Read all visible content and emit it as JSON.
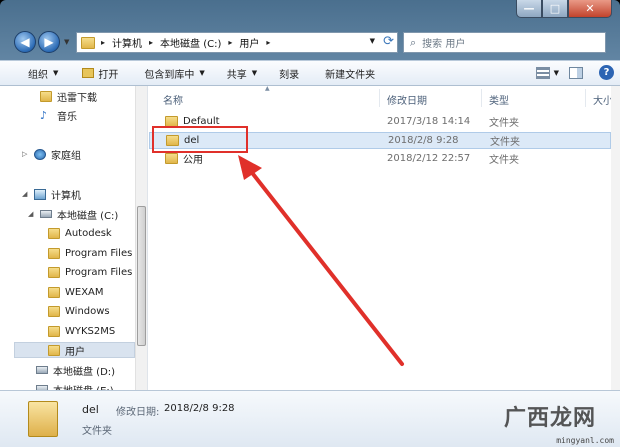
{
  "window": {
    "caption": {
      "minimize": "—",
      "maximize": "□",
      "close": "✕"
    }
  },
  "nav": {
    "back_icon": "back-arrow-icon",
    "forward_icon": "forward-arrow-icon",
    "breadcrumb": [
      "计算机",
      "本地磁盘 (C:)",
      "用户"
    ],
    "search_placeholder": "搜索 用户"
  },
  "toolbar": {
    "organize": "组织",
    "open": "打开",
    "include_in_library": "包含到库中",
    "share": "共享",
    "burn": "刻录",
    "new_folder": "新建文件夹"
  },
  "sidebar": {
    "items": [
      {
        "label": "迅雷下载",
        "icon": "download-folder-icon"
      },
      {
        "label": "音乐",
        "icon": "music-icon"
      },
      {
        "label": "家庭组",
        "icon": "homegroup-icon"
      },
      {
        "label": "计算机",
        "icon": "computer-icon"
      },
      {
        "label": "本地磁盘 (C:)",
        "icon": "drive-icon"
      },
      {
        "label": "Autodesk",
        "icon": "folder-icon"
      },
      {
        "label": "Program Files",
        "icon": "folder-icon"
      },
      {
        "label": "Program Files",
        "icon": "folder-icon"
      },
      {
        "label": "WEXAM",
        "icon": "folder-icon"
      },
      {
        "label": "Windows",
        "icon": "folder-icon"
      },
      {
        "label": "WYKS2MS",
        "icon": "folder-icon"
      },
      {
        "label": "用户",
        "icon": "folder-icon"
      },
      {
        "label": "本地磁盘 (D:)",
        "icon": "drive-icon"
      },
      {
        "label": "本地磁盘 (E:)",
        "icon": "drive-icon"
      }
    ]
  },
  "columns": {
    "name": "名称",
    "modified": "修改日期",
    "type": "类型",
    "size": "大小"
  },
  "files": [
    {
      "name": "Default",
      "modified": "2017/3/18 14:14",
      "type": "文件夹"
    },
    {
      "name": "del",
      "modified": "2018/2/8 9:28",
      "type": "文件夹"
    },
    {
      "name": "公用",
      "modified": "2018/2/12 22:57",
      "type": "文件夹"
    }
  ],
  "details": {
    "name": "del",
    "modified_label": "修改日期:",
    "modified": "2018/2/8 9:28",
    "type": "文件夹"
  },
  "watermark": {
    "text": "广西龙网",
    "url": "mingyanl.com"
  },
  "colors": {
    "highlight": "#e0302a",
    "selection": "#dce9f7"
  }
}
